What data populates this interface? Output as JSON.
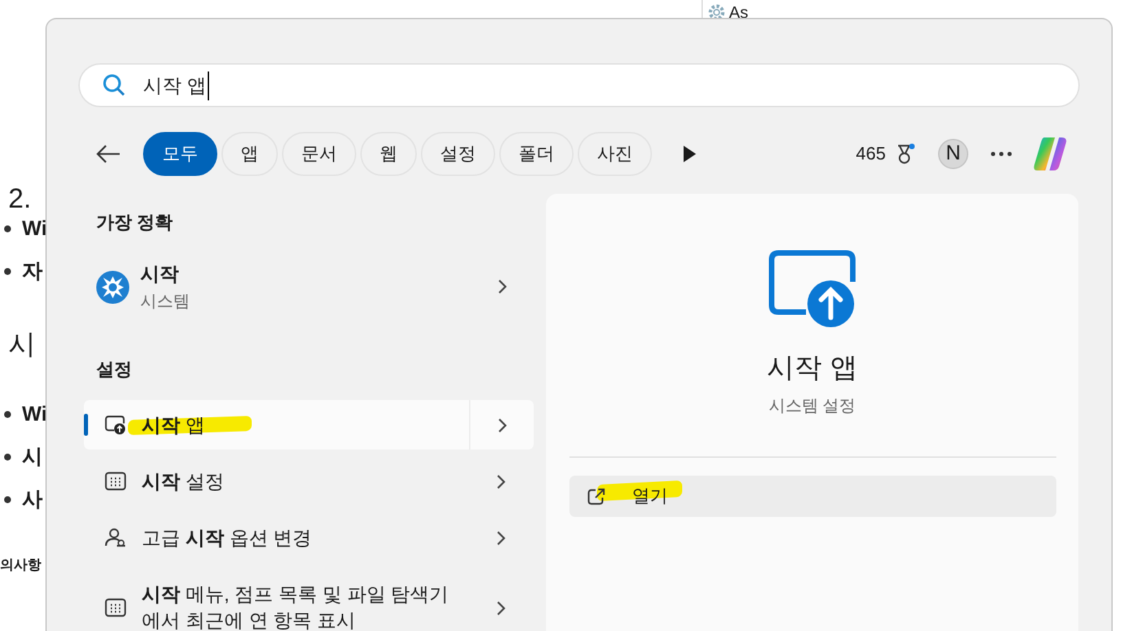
{
  "background_document": {
    "heading_1": "2.",
    "bullets_1": [
      "Wi",
      "자"
    ],
    "heading_2": "시",
    "bullets_2": [
      "Wi",
      "시",
      "사"
    ],
    "footer_text": "의사항",
    "corner_label": "As"
  },
  "search": {
    "value": "시작 앱"
  },
  "filters": [
    {
      "label": "모두",
      "selected": true
    },
    {
      "label": "앱",
      "selected": false
    },
    {
      "label": "문서",
      "selected": false
    },
    {
      "label": "웹",
      "selected": false
    },
    {
      "label": "설정",
      "selected": false
    },
    {
      "label": "폴더",
      "selected": false
    },
    {
      "label": "사진",
      "selected": false
    }
  ],
  "points": "465",
  "avatar_initial": "N",
  "best_match": {
    "heading": "가장 정확",
    "title": "시작",
    "subtitle": "시스템"
  },
  "settings_heading": "설정",
  "results": [
    {
      "kind": "app",
      "title": "**시작** 앱",
      "selected": true,
      "highlighted": true
    },
    {
      "kind": "settings",
      "title": "**시작** 설정",
      "selected": false,
      "highlighted": false
    },
    {
      "kind": "advanced",
      "title": "고급 **시작** 옵션 변경",
      "selected": false,
      "highlighted": false
    },
    {
      "kind": "settings",
      "title": "**시작** 메뉴, 점프 목록 및 파일 탐색기에서 최근에 연 항목 표시",
      "selected": false,
      "highlighted": false
    }
  ],
  "detail": {
    "title": "시작 앱",
    "subtitle": "시스템 설정",
    "action": {
      "label": "열기",
      "highlighted": true
    }
  }
}
